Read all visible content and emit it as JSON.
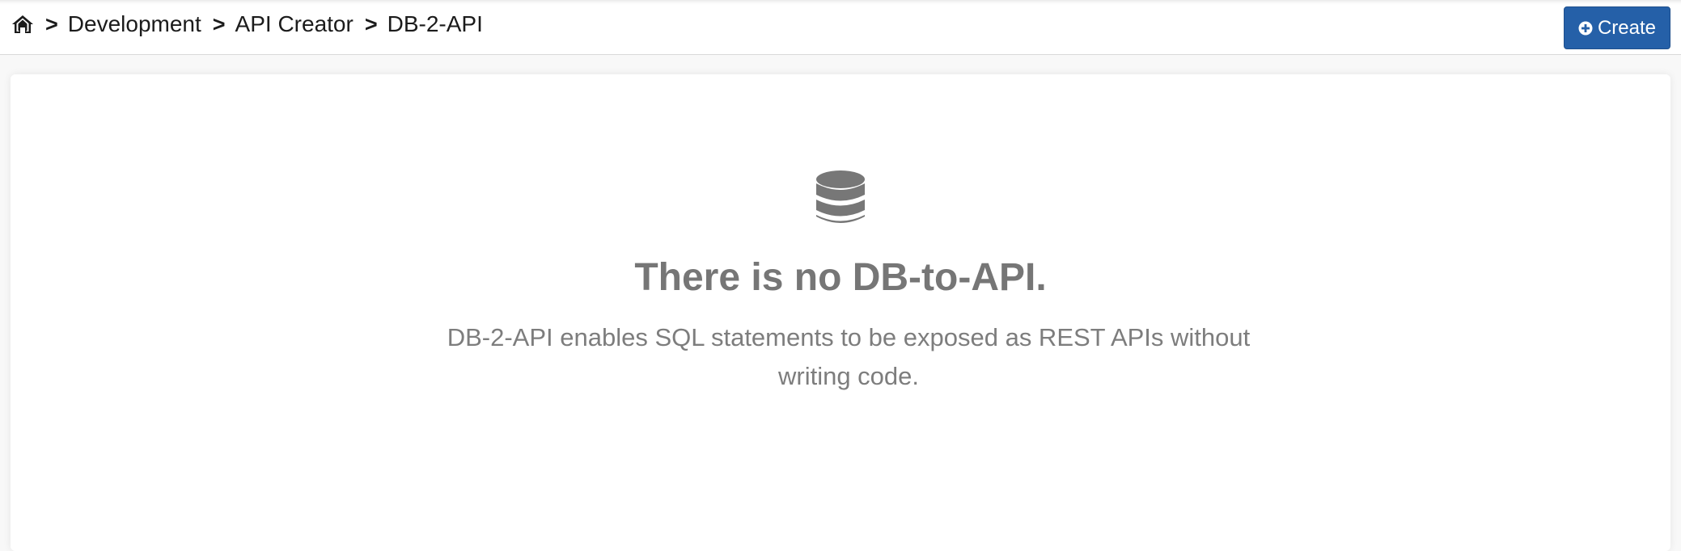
{
  "breadcrumb": {
    "home_icon": "home-icon",
    "separator": ">",
    "items": [
      "Development",
      "API Creator",
      "DB-2-API"
    ]
  },
  "toolbar": {
    "create_label": "Create",
    "create_icon": "plus-circle-icon",
    "create_color": "#2560a8"
  },
  "empty_state": {
    "icon": "database-icon",
    "title": "There is no DB-to-API.",
    "description": "DB-2-API enables SQL statements to be exposed as REST APIs without writing code."
  }
}
